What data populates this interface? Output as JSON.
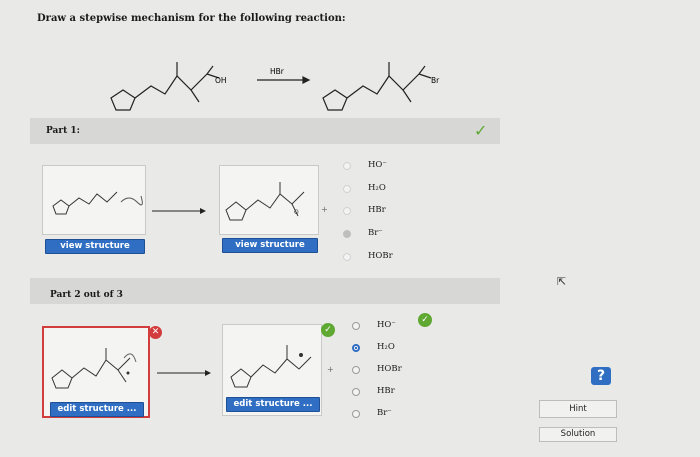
{
  "question": {
    "prompt": "Draw a stepwise mechanism for the following reaction:",
    "reagent": "HBr",
    "reactant_group": "OH",
    "product_group": "Br"
  },
  "part1": {
    "label": "Part 1:",
    "view_button_1": "view structure",
    "view_button_2": "view structure",
    "plus": "+",
    "options": [
      "HO⁻",
      "H₂O",
      "HBr",
      "Br⁻",
      "HOBr"
    ],
    "selected": "HBr"
  },
  "part2": {
    "label": "Part 2 out of 3",
    "edit_button_1": "edit structure ...",
    "edit_button_2": "edit structure ...",
    "plus": "+",
    "options": [
      "HO⁻",
      "H₂O",
      "HOBr",
      "HBr",
      "Br⁻"
    ],
    "selected": "H₂O"
  },
  "side": {
    "help_icon": "?",
    "hint_label": "Hint",
    "solution_label": "Solution"
  },
  "colors": {
    "accent": "#2f6ec2",
    "success": "#5fa832",
    "error": "#d23c3c"
  },
  "icons": [
    "check-icon",
    "x-icon",
    "help-icon",
    "arrow-icon",
    "cursor-icon"
  ]
}
